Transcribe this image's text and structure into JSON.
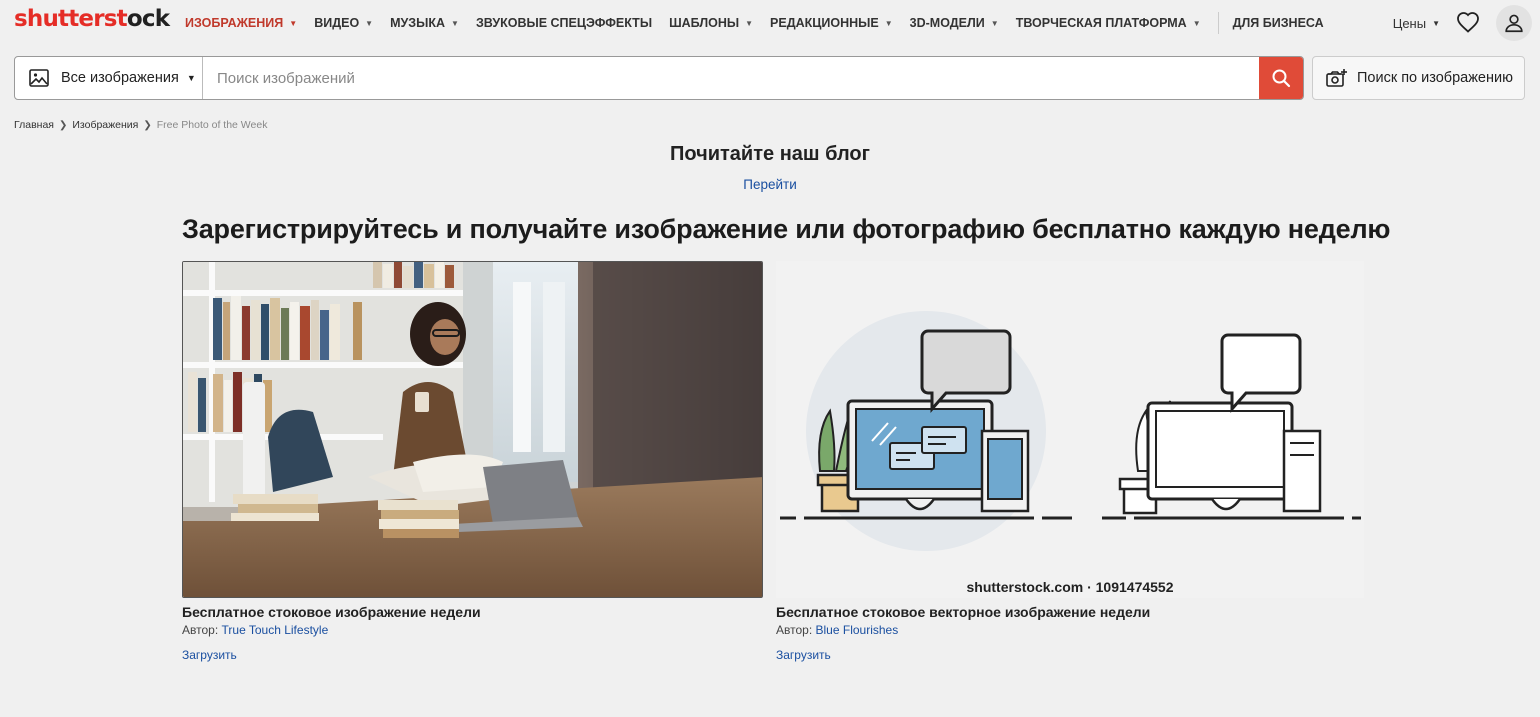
{
  "logo": {
    "part1": "shutterst",
    "part2": "o",
    "part3": "ck"
  },
  "nav": {
    "items": [
      {
        "label": "ИЗОБРАЖЕНИЯ",
        "dropdown": true,
        "active": true
      },
      {
        "label": "ВИДЕО",
        "dropdown": true
      },
      {
        "label": "МУЗЫКА",
        "dropdown": true
      },
      {
        "label": "ЗВУКОВЫЕ СПЕЦЭФФЕКТЫ",
        "dropdown": false
      },
      {
        "label": "ШАБЛОНЫ",
        "dropdown": true
      },
      {
        "label": "РЕДАКЦИОННЫЕ",
        "dropdown": true
      },
      {
        "label": "3D-МОДЕЛИ",
        "dropdown": true
      },
      {
        "label": "ТВОРЧЕСКАЯ ПЛАТФОРМА",
        "dropdown": true
      }
    ],
    "business": "ДЛЯ БИЗНЕСА",
    "prices": "Цены"
  },
  "search": {
    "type_label": "Все изображения",
    "placeholder": "Поиск изображений",
    "image_search_label": "Поиск по изображению"
  },
  "breadcrumb": {
    "home": "Главная",
    "images": "Изображения",
    "current": "Free Photo of the Week"
  },
  "blog": {
    "title": "Почитайте наш блог",
    "link": "Перейти"
  },
  "headline": "Зарегистрируйтесь и получайте изображение или фотографию бесплатно каждую неделю",
  "cards": [
    {
      "title": "Бесплатное стоковое изображение недели",
      "author_prefix": "Автор:",
      "author": "True Touch Lifestyle",
      "download": "Загрузить"
    },
    {
      "title": "Бесплатное стоковое векторное изображение недели",
      "author_prefix": "Автор:",
      "author": "Blue Flourishes",
      "download": "Загрузить",
      "watermark": "shutterstock.com · 1091474552"
    }
  ],
  "colors": {
    "accent": "#e52d27",
    "link": "#1a4fa0",
    "search_button": "#e04b38"
  },
  "icons": [
    "image-icon",
    "search-icon",
    "camera-plus-icon",
    "heart-icon",
    "user-icon",
    "chevron-down-icon",
    "chevron-right-icon"
  ]
}
